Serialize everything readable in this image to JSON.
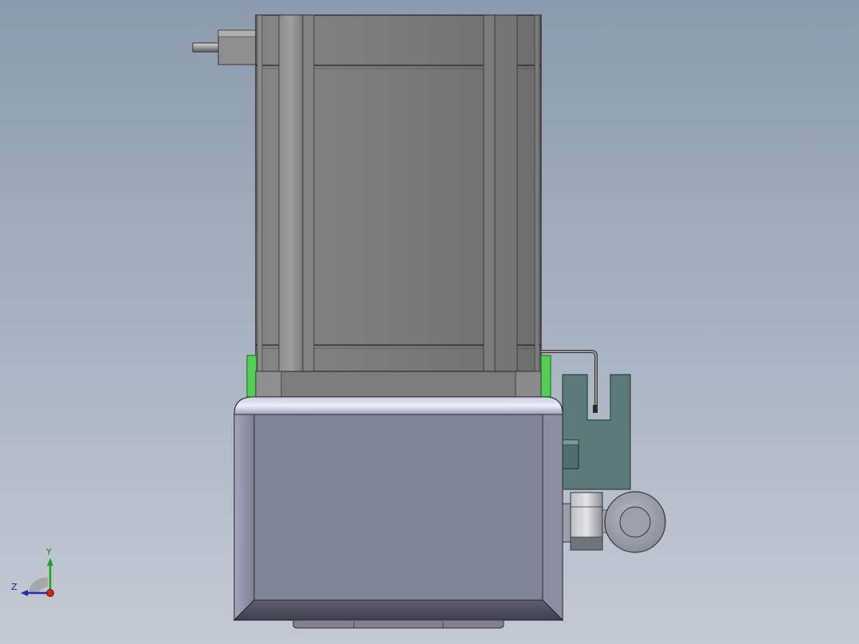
{
  "triad": {
    "y_label": "Y",
    "z_label": "Z",
    "colors": {
      "y_axis": "#1fa31f",
      "z_axis": "#1f2fb5",
      "x_axis": "#d21f1f"
    }
  },
  "colors": {
    "background_top": "#8b9bad",
    "background_bottom": "#c4cad3",
    "motor_body": "#7a7a7a",
    "housing": "#818598",
    "mount_green": "#4fc94f",
    "bracket": "#5a7a78",
    "fitting": "#8e9298"
  }
}
